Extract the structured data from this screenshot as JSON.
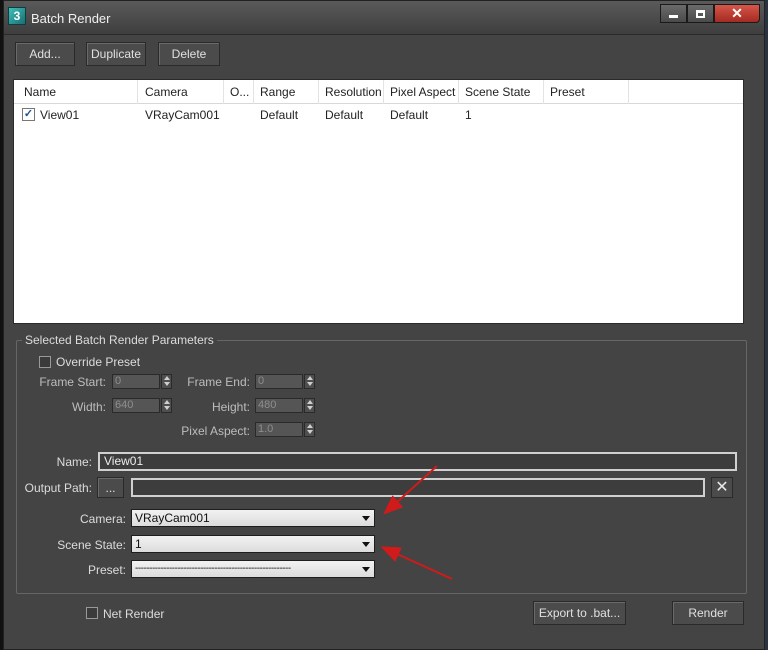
{
  "window": {
    "title": "Batch Render",
    "controls": {
      "minimize": "minimize",
      "maximize": "maximize",
      "close": "✕"
    }
  },
  "toolbar": {
    "add_label": "Add...",
    "duplicate_label": "Duplicate",
    "delete_label": "Delete"
  },
  "list": {
    "columns": [
      "Name",
      "Camera",
      "O...",
      "Range",
      "Resolution",
      "Pixel Aspect",
      "Scene State",
      "Preset"
    ],
    "rows": [
      {
        "checked": true,
        "check_glyph": "✓",
        "name": "View01",
        "camera": "VRayCam001",
        "output": "",
        "range": "Default",
        "resolution": "Default",
        "pixel_aspect": "Default",
        "scene_state": "1",
        "preset": ""
      }
    ]
  },
  "params": {
    "group_title": "Selected Batch Render Parameters",
    "override_preset_label": "Override Preset",
    "frame_start_label": "Frame Start:",
    "frame_start_value": "0",
    "frame_end_label": "Frame End:",
    "frame_end_value": "0",
    "width_label": "Width:",
    "width_value": "640",
    "height_label": "Height:",
    "height_value": "480",
    "pixel_aspect_label": "Pixel Aspect:",
    "pixel_aspect_value": "1.0",
    "name_label": "Name:",
    "name_value": "View01",
    "output_path_label": "Output Path:",
    "output_browse_label": "...",
    "output_path_value": "",
    "output_clear_glyph": "✕",
    "camera_label": "Camera:",
    "camera_value": "VRayCam001",
    "scene_state_label": "Scene State:",
    "scene_state_value": "1",
    "preset_label": "Preset:",
    "preset_value": "-------------------------------------------------------"
  },
  "footer": {
    "net_render_label": "Net Render",
    "export_label": "Export to .bat...",
    "render_label": "Render"
  },
  "colors": {
    "annotation_arrow": "#d11a1a",
    "dialog_bg": "#444444",
    "title_close": "#c0392b"
  }
}
